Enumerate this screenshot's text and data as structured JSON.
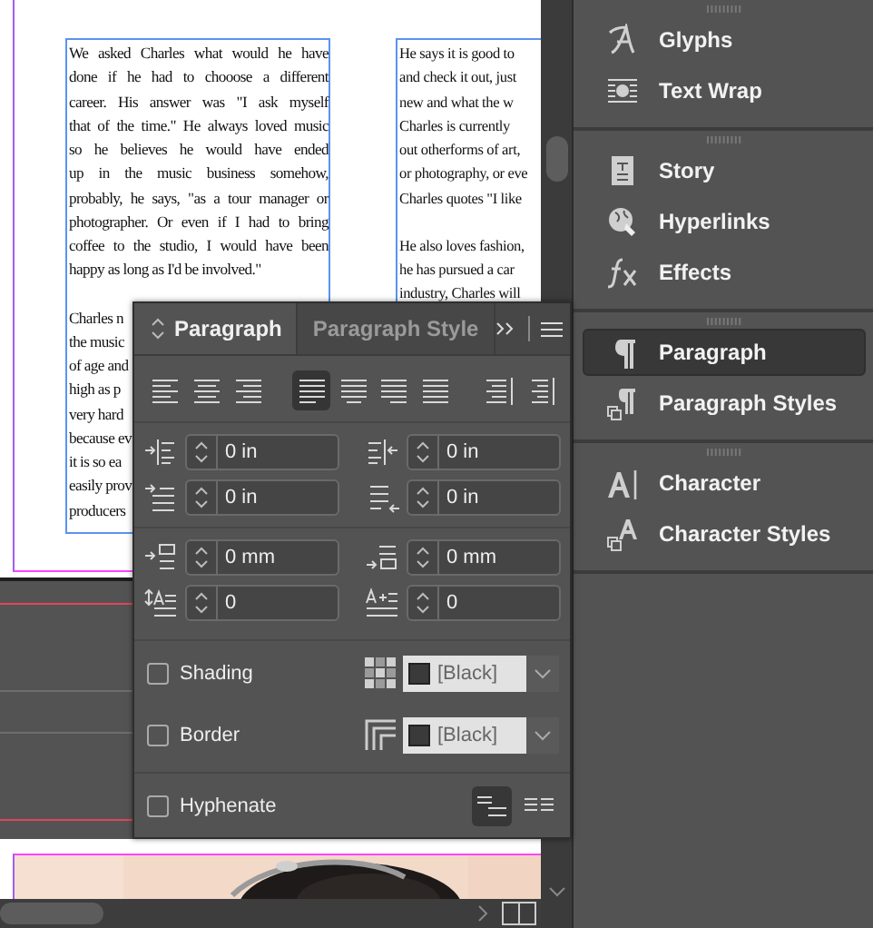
{
  "document": {
    "column_1": {
      "paragraphs": [
        [
          "We asked Charles what would he have",
          "done if he had to chooose a different",
          "career. His answer was \"I ask myself",
          "that of the time.\" He always loved music",
          "so he believes he would have ended",
          "up in the music business somehow,",
          "probably, he says, \"as a tour manager or",
          "photographer. Or even if I had to bring",
          "coffee to the studio, I would have been",
          "happy as long as I'd be involved.\""
        ],
        [
          "Charles n",
          "the music",
          "of age and",
          "high as p",
          "very hard",
          "because ev",
          "it is so ea",
          "easily prov",
          "producers"
        ]
      ]
    },
    "column_2": {
      "paragraphs": [
        [
          "He says it is good to",
          "and check it out, just",
          "new and what the w",
          "Charles is currently",
          "out otherforms of art,",
          "or photography, or eve",
          "Charles quotes \"I like"
        ],
        [
          "He also loves fashion,",
          "he has pursued a car",
          "industry, Charles will"
        ]
      ]
    }
  },
  "dock": {
    "groups": [
      [
        {
          "label": "Glyphs",
          "kind": "glyphs",
          "selected": false
        },
        {
          "label": "Text Wrap",
          "kind": "wrap",
          "selected": false
        }
      ],
      [
        {
          "label": "Story",
          "kind": "story",
          "selected": false
        },
        {
          "label": "Hyperlinks",
          "kind": "links",
          "selected": false
        },
        {
          "label": "Effects",
          "kind": "effects",
          "selected": false
        }
      ],
      [
        {
          "label": "Paragraph",
          "kind": "para",
          "selected": true
        },
        {
          "label": "Paragraph Styles",
          "kind": "parastyles",
          "selected": false
        }
      ],
      [
        {
          "label": "Character",
          "kind": "char",
          "selected": false
        },
        {
          "label": "Character Styles",
          "kind": "charstyles",
          "selected": false
        }
      ]
    ]
  },
  "paragraph_panel": {
    "tabs": [
      {
        "label": "Paragraph",
        "selected": true
      },
      {
        "label": "Paragraph Style",
        "selected": false
      }
    ],
    "alignment": [
      {
        "kind": "left",
        "selected": false
      },
      {
        "kind": "center",
        "selected": false
      },
      {
        "kind": "right",
        "selected": false
      },
      {
        "kind": "justify_left",
        "selected": true
      },
      {
        "kind": "justify_center",
        "selected": false
      },
      {
        "kind": "justify_right",
        "selected": false
      },
      {
        "kind": "justify_all",
        "selected": false
      },
      {
        "kind": "toward_spine",
        "selected": false
      },
      {
        "kind": "away_spine",
        "selected": false
      }
    ],
    "field_rows": [
      [
        {
          "kind": "left_indent",
          "value": "0 in"
        },
        {
          "kind": "right_indent",
          "value": "0 in"
        }
      ],
      [
        {
          "kind": "first_line",
          "value": "0 in"
        },
        {
          "kind": "last_line",
          "value": "0 in"
        }
      ],
      [
        {
          "kind": "space_before",
          "value": "0 mm"
        },
        {
          "kind": "space_after",
          "value": "0 mm"
        }
      ],
      [
        {
          "kind": "drop_lines",
          "value": "0"
        },
        {
          "kind": "drop_chars",
          "value": "0"
        }
      ]
    ],
    "options": [
      {
        "kind": "shading",
        "label": "Shading",
        "checked": false,
        "swatch": "[Black]"
      },
      {
        "kind": "border",
        "label": "Border",
        "checked": false,
        "swatch": "[Black]"
      },
      {
        "kind": "hyphenate",
        "label": "Hyphenate",
        "checked": false,
        "modes": [
          {
            "kind": "single",
            "selected": true
          },
          {
            "kind": "multi",
            "selected": false
          }
        ]
      }
    ]
  }
}
